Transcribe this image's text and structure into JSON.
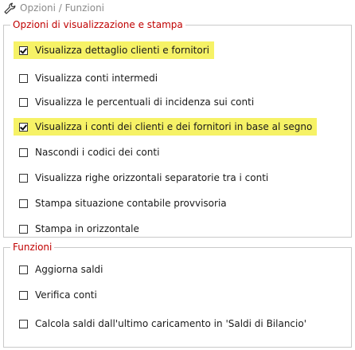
{
  "window": {
    "title": "Opzioni / Funzioni",
    "icon": "wrench-icon"
  },
  "opzioni": {
    "title": "Opzioni di visualizzazione e stampa",
    "items": [
      {
        "label": "Visualizza dettaglio clienti e fornitori",
        "checked": true,
        "highlighted": true
      },
      {
        "label": "Visualizza conti intermedi",
        "checked": false,
        "highlighted": false
      },
      {
        "label": "Visualizza le percentuali di incidenza sui conti",
        "checked": false,
        "highlighted": false
      },
      {
        "label": "Visualizza i conti dei clienti e dei fornitori in base al segno",
        "checked": true,
        "highlighted": true
      },
      {
        "label": "Nascondi i codici dei conti",
        "checked": false,
        "highlighted": false
      },
      {
        "label": "Visualizza righe orizzontali separatorie tra i conti",
        "checked": false,
        "highlighted": false
      },
      {
        "label": "Stampa situazione contabile provvisoria",
        "checked": false,
        "highlighted": false
      },
      {
        "label": "Stampa in orizzontale",
        "checked": false,
        "highlighted": false
      }
    ]
  },
  "funzioni": {
    "title": "Funzioni",
    "items": [
      {
        "label": "Aggiorna saldi",
        "checked": false
      },
      {
        "label": "Verifica conti",
        "checked": false
      },
      {
        "label": "Calcola saldi dall'ultimo caricamento in 'Saldi di Bilancio'",
        "checked": false
      }
    ]
  },
  "colors": {
    "highlight": "#f6f266",
    "group_title": "#c00000",
    "window_title": "#8a8a8a"
  }
}
